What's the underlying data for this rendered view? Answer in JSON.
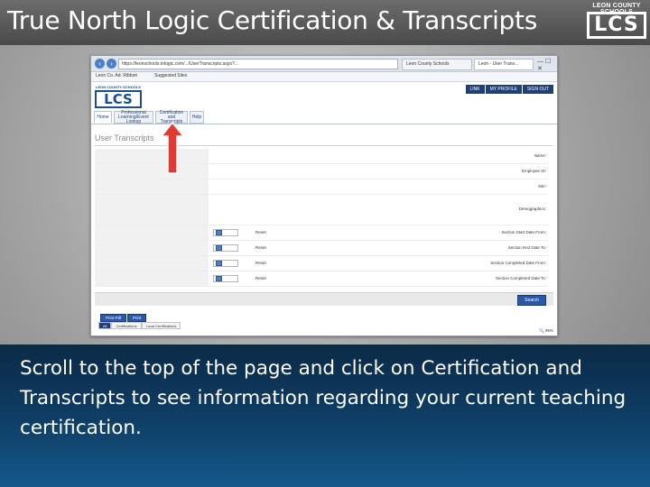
{
  "slide": {
    "title": "True North Logic Certification & Transcripts",
    "logo_top_text": "LEON COUNTY SCHOOLS",
    "logo_letters": "LCS",
    "instruction": "Scroll to the top of the page and click on Certification and Transcripts to see information regarding your current teaching certification."
  },
  "browser": {
    "url": "https://leonschools.tnlogic.com/.../UserTranscripts.aspx?...",
    "tabs": [
      {
        "label": "Leon County Schools",
        "active": false
      },
      {
        "label": "Leon - User Trans...",
        "active": true
      }
    ],
    "favorites": [
      "Leon Co. Ad. Ribbon",
      "Suggested Sites"
    ],
    "win_controls": "— ☐ ✕"
  },
  "site": {
    "logo_top_text": "LEON COUNTY SCHOOLS",
    "logo_letters": "LCS",
    "top_links": [
      "LINK",
      "MY PROFILE",
      "SIGN OUT"
    ],
    "tabs": [
      {
        "label": "Home",
        "selected": true
      },
      {
        "label": "Professional Learning/Event Lookup",
        "selected": false
      },
      {
        "label": "Certification and Transcripts",
        "selected": false
      },
      {
        "label": "Help",
        "selected": false
      }
    ],
    "page_heading": "User Transcripts",
    "fields": [
      {
        "label": "Name:",
        "has_date": false
      },
      {
        "label": "Employee ID:",
        "has_date": false
      },
      {
        "label": "Site:",
        "has_date": false
      },
      {
        "label": "Demographics:",
        "has_date": false
      },
      {
        "label": "Section Start Date From:",
        "has_date": true
      },
      {
        "label": "Section End Date To:",
        "has_date": true
      },
      {
        "label": "Section Completed Date From:",
        "has_date": true
      },
      {
        "label": "Section Completed Date To:",
        "has_date": true
      }
    ],
    "reset_label": "Reset",
    "search_label": "Search",
    "print_label": "Print Pdf",
    "export_label": "Print",
    "subtabs": [
      {
        "label": "All",
        "selected": true
      },
      {
        "label": "Certifications",
        "selected": false
      },
      {
        "label": "Local Certifications",
        "selected": false
      }
    ],
    "zoom": "🔍 95%"
  },
  "colors": {
    "arrow": "#e03a33",
    "panel": "#0f3f66",
    "site_blue": "#1f3f77"
  }
}
